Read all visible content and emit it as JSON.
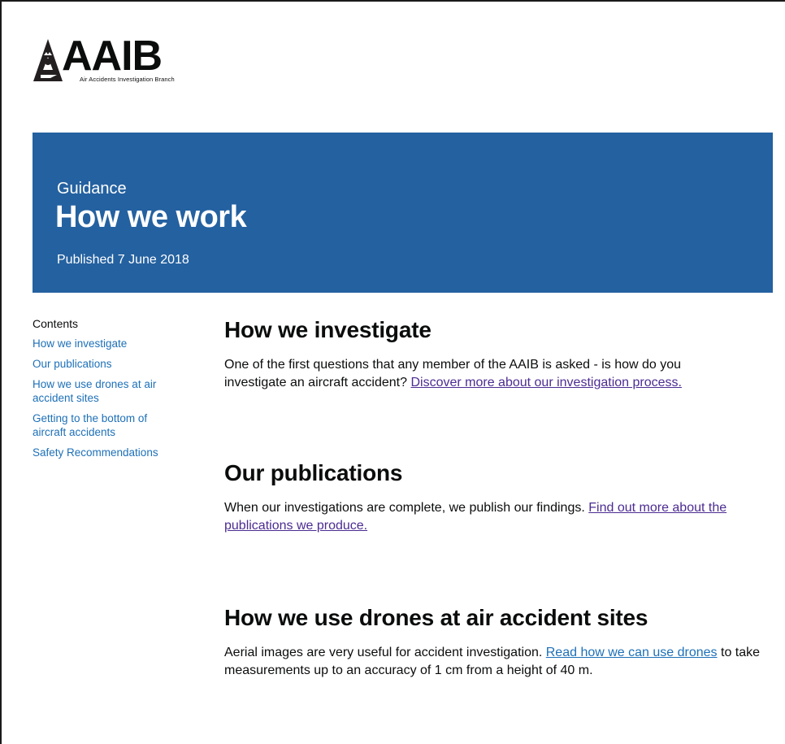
{
  "logo": {
    "wordmark": "AAIB",
    "subtitle": "Air Accidents Investigation Branch"
  },
  "hero": {
    "kicker": "Guidance",
    "title": "How we work",
    "published": "Published 7 June 2018"
  },
  "contents": {
    "label": "Contents",
    "items": [
      {
        "label": "How we investigate"
      },
      {
        "label": "Our publications"
      },
      {
        "label": "How we use drones at air accident sites"
      },
      {
        "label": "Getting to the bottom of aircraft accidents"
      },
      {
        "label": "Safety Recommendations"
      }
    ]
  },
  "sections": [
    {
      "heading": "How we investigate",
      "text": "One of the first questions that any member of the AAIB is asked - is how do you investigate an aircraft accident? ",
      "link": "Discover more about our investigation process.",
      "after": ""
    },
    {
      "heading": "Our publications",
      "text": "When our investigations are complete, we publish our findings. ",
      "link": "Find out more about the publications we produce.",
      "after": ""
    },
    {
      "heading": "How we use drones at air accident sites",
      "text": "Aerial images are very useful for accident investigation. ",
      "link": "Read how we can use drones",
      "after": " to take measurements up to an accuracy of 1 cm from a height of 40 m."
    }
  ],
  "colors": {
    "hero_background": "#2461a0",
    "link": "#1d70b8",
    "visited_link": "#4c2c92"
  }
}
